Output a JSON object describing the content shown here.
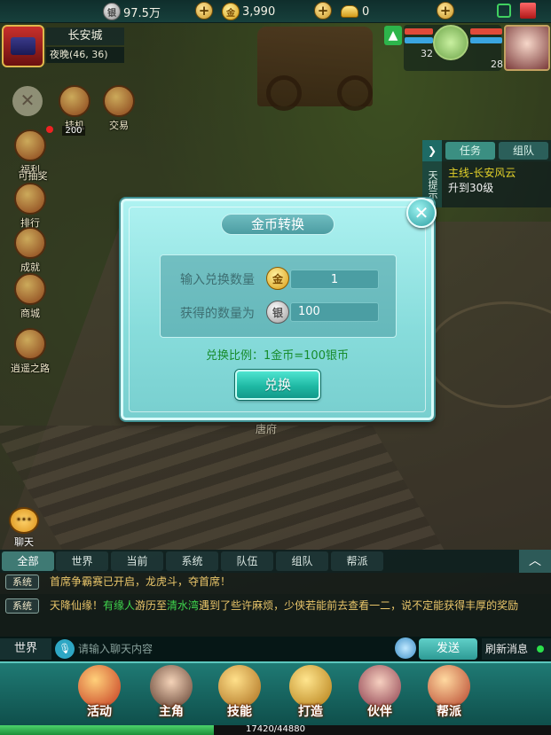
{
  "topbar": {
    "silver": "97.5万",
    "gold": "3,990",
    "ingot": "0"
  },
  "location": {
    "city": "长安城",
    "coords": "夜晚(46, 36)"
  },
  "party": {
    "pet_level": "32",
    "hero_level": "28"
  },
  "side_menu": {
    "hangup": "挂机",
    "hangup_count": "200",
    "trade": "交易",
    "welfare": "福利",
    "draw": "可抽奖",
    "ranking": "排行",
    "achievement": "成就",
    "shop": "商城",
    "fortune_road": "逍遥之路"
  },
  "quest": {
    "tab_task": "任务",
    "tab_team": "组队",
    "side_label": "天提示",
    "line1": "主线-长安风云",
    "line2": "升到30级"
  },
  "scene": {
    "gate_label": "唐府"
  },
  "dialog": {
    "title": "金币转换",
    "input_label": "输入兑换数量",
    "input_value": "1",
    "output_label": "获得的数量为",
    "output_value": "100",
    "ratio": "兑换比例：1金币=100银币",
    "button": "兑换"
  },
  "chat": {
    "bubble": "聊天",
    "tabs": [
      "全部",
      "世界",
      "当前",
      "系统",
      "队伍",
      "组队",
      "帮派"
    ],
    "messages": [
      {
        "tag": "系统",
        "text": "首席争霸赛已开启，龙虎斗，夺首席！"
      },
      {
        "tag": "系统",
        "p1": "天降仙缘！",
        "h1": "有缘人",
        "p2": "游历至",
        "h2": "清水湾",
        "p3": "遇到了些许麻烦，少侠若能前去查看一二，说不定能获得丰厚的奖励"
      }
    ],
    "channel": "世界",
    "placeholder": "请输入聊天内容",
    "send": "发送",
    "refresh": "刷新消息"
  },
  "bottom_menu": {
    "activity": "活动",
    "hero": "主角",
    "skill": "技能",
    "forge": "打造",
    "partner": "伙伴",
    "guild": "帮派"
  },
  "xp": {
    "text": "17420/44880",
    "fraction": 0.388
  },
  "colors": {
    "dialog_bg": "#87dcdb",
    "ratio_text": "#178c2c",
    "chat_highlight": "#3fd44c"
  }
}
